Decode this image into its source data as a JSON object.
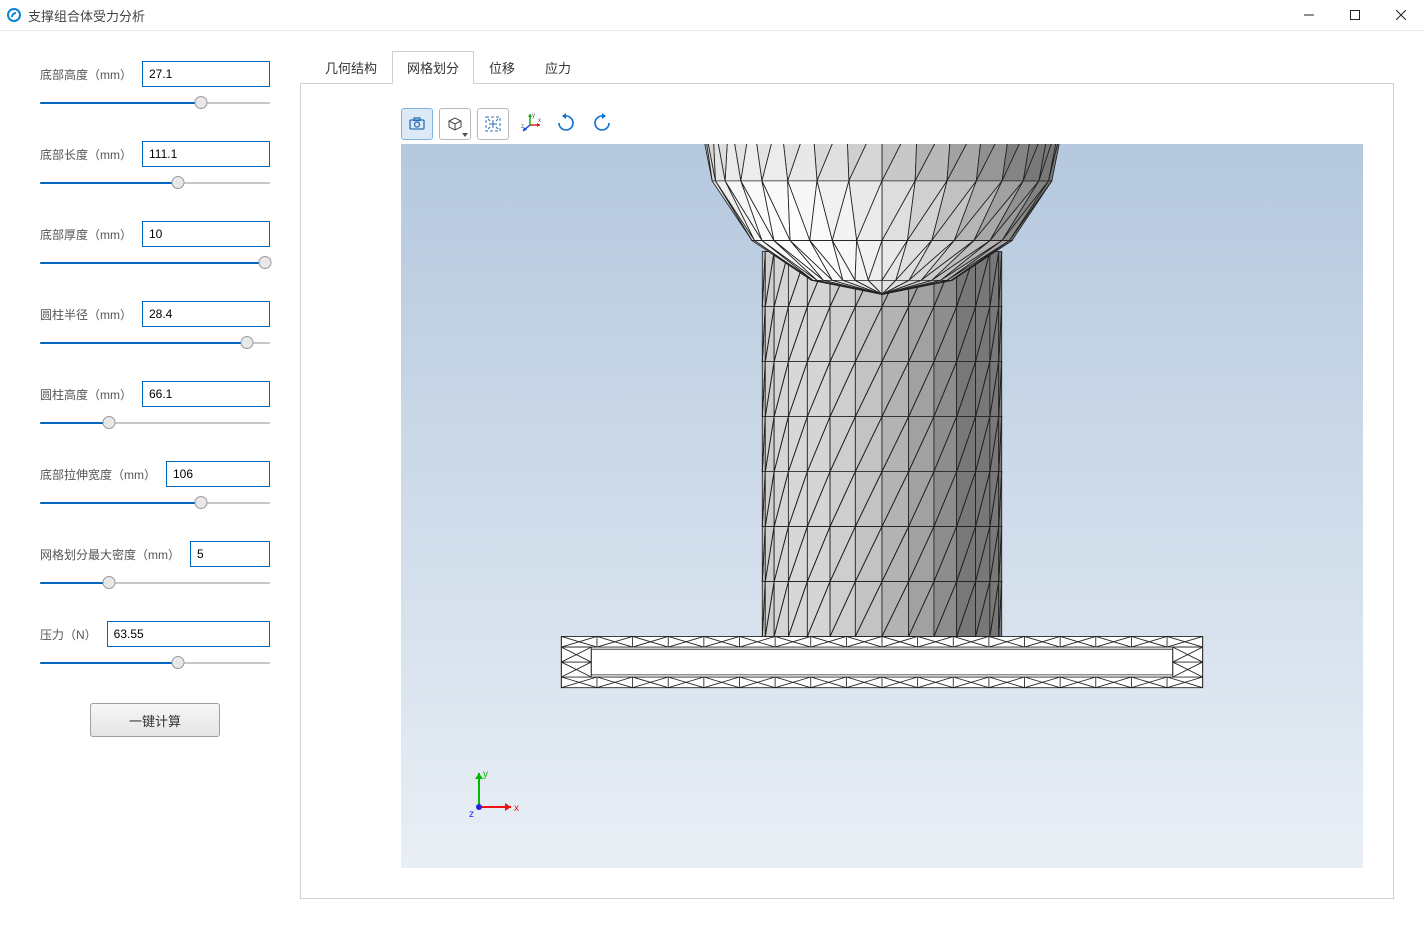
{
  "window": {
    "title": "支撑组合体受力分析"
  },
  "params": [
    {
      "label": "底部高度（mm）",
      "value": "27.1",
      "pct": 70
    },
    {
      "label": "底部长度（mm）",
      "value": "111.1",
      "pct": 60
    },
    {
      "label": "底部厚度（mm）",
      "value": "10",
      "pct": 98
    },
    {
      "label": "圆柱半径（mm）",
      "value": "28.4",
      "pct": 90
    },
    {
      "label": "圆柱高度（mm）",
      "value": "66.1",
      "pct": 30
    },
    {
      "label": "底部拉伸宽度（mm）",
      "value": "106",
      "pct": 70
    },
    {
      "label": "网格划分最大密度（mm）",
      "value": "5",
      "pct": 30
    },
    {
      "label": "压力（N）",
      "value": "63.55",
      "pct": 60
    }
  ],
  "button": {
    "compute": "一键计算"
  },
  "tabs": [
    "几何结构",
    "网格划分",
    "位移",
    "应力"
  ],
  "active_tab": 1,
  "triad": {
    "x": "x",
    "y": "y",
    "z": "z"
  }
}
